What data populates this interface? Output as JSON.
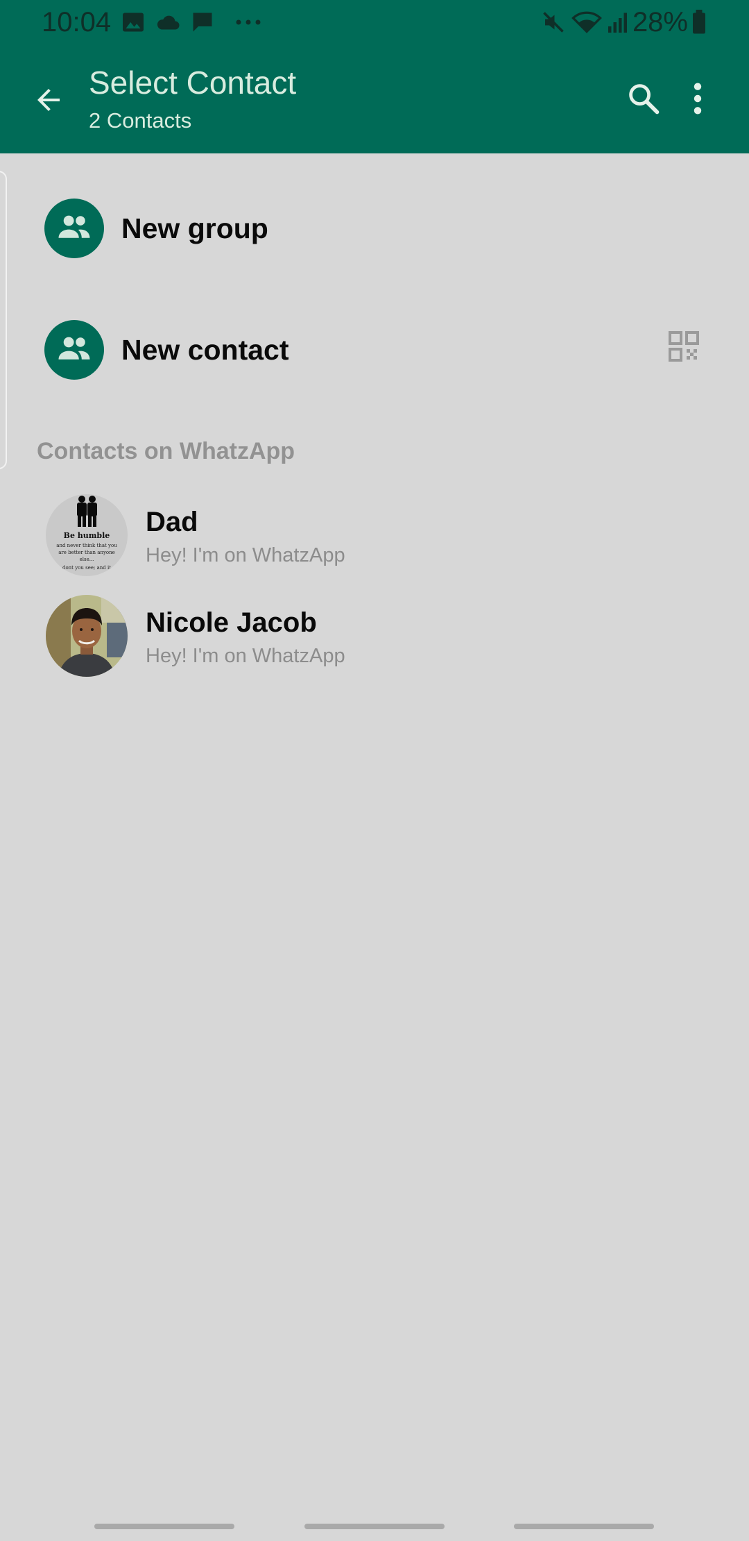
{
  "status_bar": {
    "time": "10:04",
    "battery": "28%",
    "icons": [
      "image-icon",
      "cloud-icon",
      "message-icon",
      "more-notifications-icon",
      "mute-icon",
      "wifi-icon",
      "signal-icon",
      "battery-icon"
    ]
  },
  "app_bar": {
    "title": "Select Contact",
    "subtitle": "2 Contacts",
    "icons": [
      "back-arrow-icon",
      "search-icon",
      "more-vert-icon"
    ]
  },
  "actions": [
    {
      "label": "New group",
      "icon": "group-icon"
    },
    {
      "label": "New contact",
      "icon": "group-icon",
      "trailing_icon": "qr-code-icon"
    }
  ],
  "section": {
    "title": "Contacts on WhatzApp"
  },
  "contacts": [
    {
      "name": "Dad",
      "status": "Hey! I'm on WhatzApp",
      "avatar_text": [
        "Be humble",
        "and never think that you",
        "are better than anyone",
        "else...",
        "dont you see; and it"
      ]
    },
    {
      "name": "Nicole Jacob",
      "status": "Hey! I'm on WhatzApp"
    }
  ],
  "colors": {
    "header": "#006b57",
    "background": "#d7d7d7",
    "avatar_accent": "#006b57",
    "secondary_text": "#8c8c8c"
  }
}
